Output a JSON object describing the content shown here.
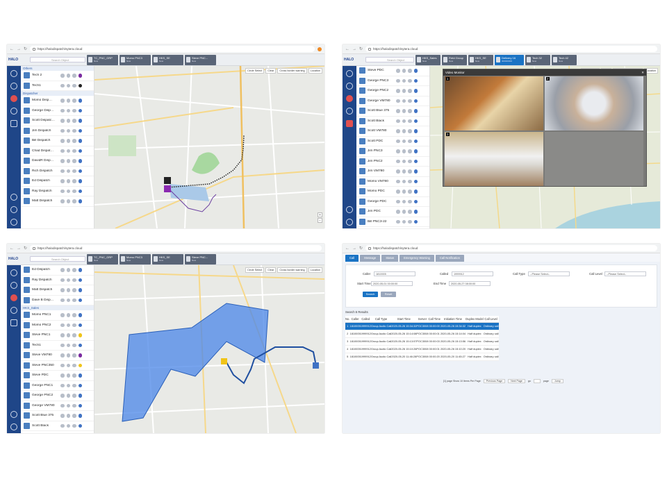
{
  "browser": {
    "url": "https://halodispatch/sytera.cloud",
    "url2": "https://halodispatch/sytera.cloud"
  },
  "app": {
    "logo": "HALO",
    "search_placeholder": "Search Object"
  },
  "panel1": {
    "tabs": [
      {
        "label": "TC_PNC_GRP",
        "sub": "Now"
      },
      {
        "label": "Momo PNC3",
        "sub": "Now"
      },
      {
        "label": "HKS_SE",
        "sub": "Now"
      },
      {
        "label": "Steve PNC...",
        "sub": "Now"
      }
    ],
    "group_top": "Others",
    "group_mid": "Dispatcher",
    "items_top": [
      "Tech 2",
      "Tech1"
    ],
    "items": [
      "Momo Disp…",
      "George Disp…",
      "Scott Dispatc…",
      "Jim Dispatch",
      "Bill Dispatch",
      "Chad Dispat…",
      "DavidR Disp…",
      "Rich Dispatch",
      "Ed Dispatch",
      "Ray Dispatch",
      "Matt Dispatch"
    ],
    "tools": [
      "Circle Select",
      "Clear",
      "Cross border warning",
      "Location"
    ]
  },
  "panel2": {
    "tabs": [
      {
        "label": "HKS_Sales",
        "sub": "Now"
      },
      {
        "label": "Field Group",
        "sub": "Now"
      },
      {
        "label": "HKS_SE",
        "sub": "Now"
      },
      {
        "label": "Delivery 16",
        "sub": "000000000"
      },
      {
        "label": "Tech 32",
        "sub": "Now"
      },
      {
        "label": "Tech 42",
        "sub": "Now"
      }
    ],
    "items": [
      "Steve PDC",
      "George PNC3",
      "George PNC2",
      "George VM780",
      "Scott Blue 375",
      "Scott Black",
      "Scott VM780",
      "Scott PDC",
      "Jim PNC3",
      "Jim PNC2",
      "Jim VM780",
      "Momo VM780",
      "Momo PDC",
      "George PDC",
      "Jim PDC",
      "Bill PNC3-22",
      "Bill PNC3-23"
    ],
    "video_monitor": {
      "title": "Video Monitor",
      "cells": [
        "1",
        "2",
        "3"
      ]
    },
    "tools": [
      "Circle Select",
      "Clear",
      "Cross border warning",
      "Location"
    ]
  },
  "panel3": {
    "tabs": [
      {
        "label": "TC_PNC_GRP",
        "sub": "Now"
      },
      {
        "label": "Momo PNC3",
        "sub": "Now"
      },
      {
        "label": "HKS_SE",
        "sub": "Now"
      },
      {
        "label": "Steve PNC...",
        "sub": "Now"
      }
    ],
    "items_top": [
      "Ed Dispatch",
      "Ray Dispatch",
      "Matt Dispatch",
      "Dave B Disp…"
    ],
    "group_mid": "HKS_Sales",
    "items": [
      "Momo PNC1",
      "Momo PNC2",
      "Steve PNC1",
      "Tech1",
      "Steve VM780",
      "Steve PNC350",
      "Steve PDC",
      "George PNC1",
      "George PNC2",
      "George VM780",
      "Scott Blue 375",
      "Scott Black"
    ],
    "tools": [
      "Circle Select",
      "Clear",
      "Cross border warning",
      "Location"
    ]
  },
  "panel4": {
    "tabs": [
      "Call",
      "Message",
      "Status",
      "Emergency Warning",
      "Call Notification"
    ],
    "form": {
      "caller_label": "Caller",
      "caller_value": "1810005",
      "called_label": "Called",
      "called_value": "1999912",
      "calltype_label": "Call Type",
      "calltype_value": "--Please Select--",
      "calllevel_label": "Call Level",
      "calllevel_value": "--Please Select--",
      "start_label": "Start Time",
      "start_value": "2020-05-01 00:00:00",
      "end_label": "End Time",
      "end_value": "2020-05-27 08:00:00",
      "search_btn": "Search",
      "reset_btn": "Reset"
    },
    "result_text": "Search 5 Results",
    "columns": [
      "No.",
      "Caller",
      "Called",
      "Call Type",
      "Start Time",
      "Server",
      "Call Time",
      "Initiation Time",
      "Duplex Model",
      "Call Level"
    ],
    "rows": [
      [
        "1",
        "1810005",
        "1999912",
        "Group Audio Call",
        "2020-05-26 15:34:32",
        "POC3008",
        "00:00:00",
        "2020-05-26 15:34:32",
        "Half duplex",
        "Ordinary call"
      ],
      [
        "2",
        "1810005",
        "1999912",
        "Group Audio Call",
        "2020-05-26 15:14:08",
        "POC3008",
        "00:00:01",
        "2020-05-26 15:14:04",
        "Half duplex",
        "Ordinary call"
      ],
      [
        "3",
        "1810005",
        "1999912",
        "Group Audio Call",
        "2020-05-26 15:13:57",
        "POC3008",
        "00:00:03",
        "2020-05-26 15:13:56",
        "Half duplex",
        "Ordinary call"
      ],
      [
        "4",
        "1810005",
        "1999912",
        "Group Audio Call",
        "2020-05-26 15:10:26",
        "POC3008",
        "00:00:01",
        "2020-05-26 15:10:20",
        "Half duplex",
        "Ordinary call"
      ],
      [
        "5",
        "1810005",
        "1999912",
        "Group Audio Call",
        "2020-05-20 11:46:28",
        "POC3008",
        "00:00:20",
        "2020-05-20 11:45:27",
        "Half duplex",
        "Ordinary call"
      ]
    ],
    "pager": {
      "info": "[1] page Show 10 Items Per Page",
      "prev": "Previous Page",
      "next": "Next Page",
      "go_label": "go",
      "page_label": "page",
      "jump": "Jump"
    }
  },
  "colors": {
    "rail": "#1f4688",
    "accent": "#1a73c4",
    "track": "#222222",
    "fence": "#4a86e8"
  }
}
